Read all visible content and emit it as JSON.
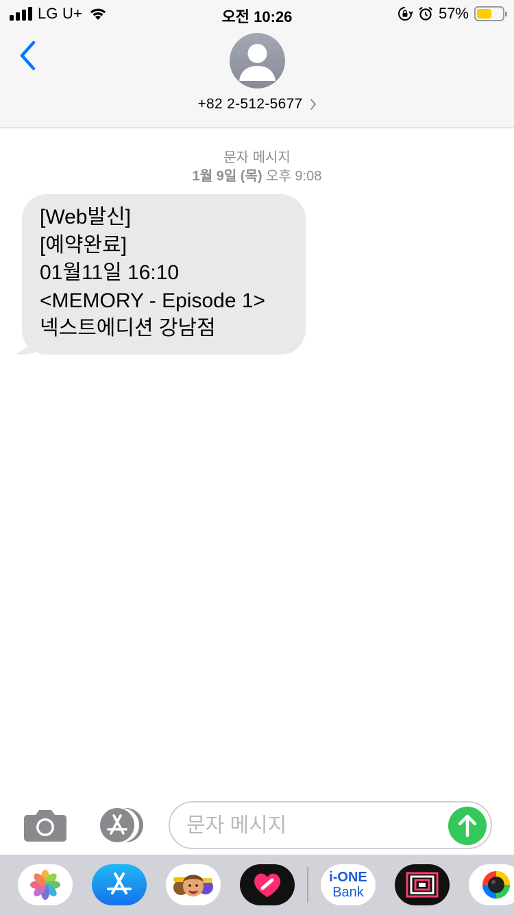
{
  "status_bar": {
    "carrier": "LG U+",
    "time": "오전 10:26",
    "battery_percent_label": "57%",
    "battery_level": 0.57,
    "icons": [
      "signal-icon",
      "wifi-icon",
      "rotation-lock-icon",
      "alarm-icon",
      "battery-icon"
    ]
  },
  "header": {
    "back_icon": "chevron-left-icon",
    "avatar_icon": "person-silhouette-icon",
    "contact_number": "+82 2-512-5677",
    "disclosure_icon": "chevron-right-icon"
  },
  "conversation": {
    "message_type": "문자 메시지",
    "date_bold": "1월 9일 (목)",
    "date_time": "오후 9:08",
    "messages": [
      {
        "direction": "incoming",
        "lines": [
          "[Web발신]",
          "[예약완료]",
          "01월11일 16:10",
          "<MEMORY - Episode 1>",
          "넥스트에디션 강남점"
        ]
      }
    ]
  },
  "input_bar": {
    "camera_icon": "camera-icon",
    "appstore_icon": "app-store-icon",
    "placeholder": "문자 메시지",
    "send_icon": "arrow-up-icon"
  },
  "app_drawer": {
    "apps": [
      {
        "name": "photos",
        "icon": "photos-icon"
      },
      {
        "name": "app-store",
        "icon": "app-store-icon"
      },
      {
        "name": "memoji",
        "icon": "memoji-icon"
      },
      {
        "name": "digital-touch",
        "icon": "heart-icon"
      },
      {
        "name": "i-ONE Bank",
        "icon": "bank-icon",
        "label_top": "i-ONE",
        "label_bottom": "Bank"
      },
      {
        "name": "frame-app",
        "icon": "frame-icon"
      },
      {
        "name": "color-app",
        "icon": "color-wheel-icon"
      }
    ]
  },
  "colors": {
    "accent_blue": "#007aff",
    "bubble_gray": "#e9e9eb",
    "send_green": "#34c759",
    "meta_gray": "#8e8e93",
    "battery_yellow": "#fecc02"
  }
}
